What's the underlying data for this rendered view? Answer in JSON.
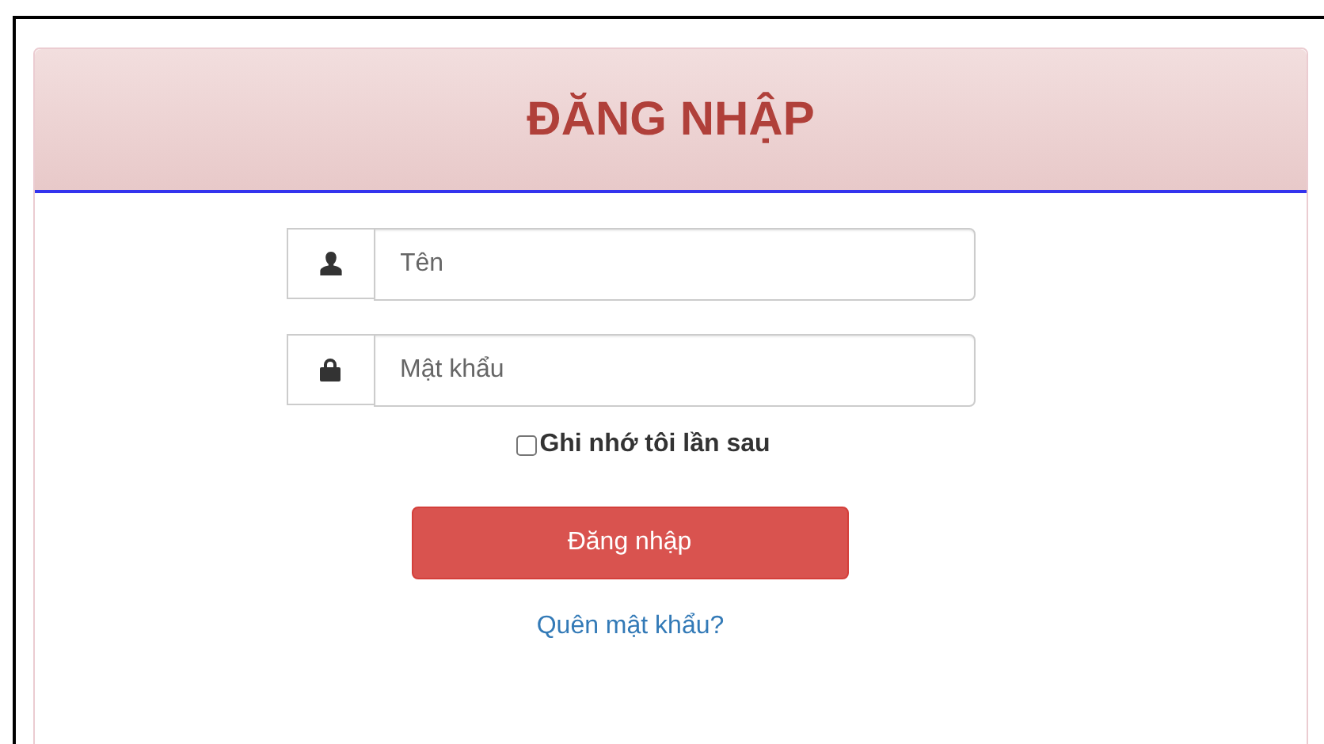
{
  "title": "ĐĂNG NHẬP",
  "fields": [
    {
      "kind": "user",
      "placeholder": "Tên"
    },
    {
      "kind": "lock",
      "placeholder": "Mật khẩu"
    }
  ],
  "remember": {
    "label": "Ghi nhớ tôi lần sau",
    "checked": false
  },
  "submit": "Đăng nhập",
  "forgot": "Quên mật khẩu?"
}
